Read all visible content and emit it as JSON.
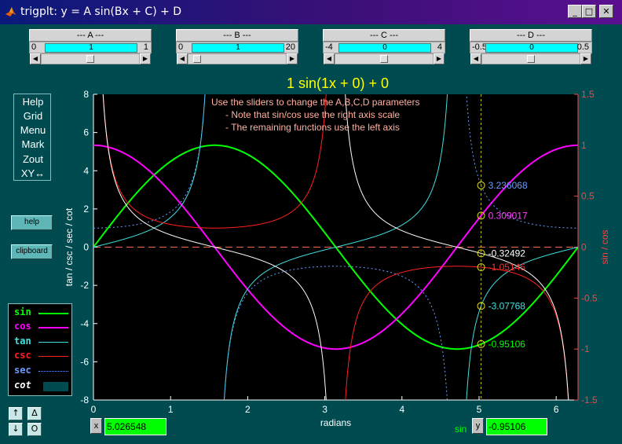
{
  "window": {
    "title": "trigplt: y = A sin(Bx + C) + D",
    "minimize_glyph": "_",
    "maximize_glyph": "□",
    "close_glyph": "✕"
  },
  "sliders": [
    {
      "name": "--- A ---",
      "min": "0",
      "max": "1",
      "value": "1",
      "fraction": 0.5
    },
    {
      "name": "--- B ---",
      "min": "0",
      "max": "20",
      "value": "1",
      "fraction": 0.05
    },
    {
      "name": "--- C ---",
      "min": "-4",
      "max": "4",
      "value": "0",
      "fraction": 0.5
    },
    {
      "name": "--- D ---",
      "min": "-0.5",
      "max": "0.5",
      "value": "0",
      "fraction": 0.5
    }
  ],
  "plot": {
    "title": "1 sin(1x + 0) + 0",
    "annotations": [
      "Use the sliders to change the A,B,C,D parameters",
      "- Note that sin/cos use the right axis scale",
      "- The remaining functions use the left axis"
    ]
  },
  "menu": [
    "Help",
    "Grid",
    "Menu",
    "Mark",
    "Zout",
    "XY↔"
  ],
  "buttons": {
    "help": "help",
    "clipboard": "clipboard"
  },
  "legend": [
    {
      "label": "sin",
      "color": "#00ff00",
      "style": "solid"
    },
    {
      "label": "cos",
      "color": "#ff00ff",
      "style": "solid"
    },
    {
      "label": "tan",
      "color": "#40e0e0",
      "style": "solid"
    },
    {
      "label": "csc",
      "color": "#ff2020",
      "style": "solid"
    },
    {
      "label": "sec",
      "color": "#6a9cff",
      "style": "dotted"
    },
    {
      "label": "cot",
      "color": "#ffffff",
      "style": "swatch"
    }
  ],
  "nav": {
    "up": "↑",
    "down": "↓",
    "delta": "Δ",
    "zero": "O"
  },
  "readout": {
    "x_button": "x",
    "x_value": "5.026548",
    "y_button": "y",
    "y_value": "-0.95106",
    "y_series": "sin"
  },
  "chart_data": {
    "type": "line",
    "xlabel": "radians",
    "ylabel_left": "tan / csc / sec / cot",
    "ylabel_right": "sin / cos",
    "xlim": [
      0,
      6.2832
    ],
    "ylim_left": [
      -8,
      8
    ],
    "ylim_right": [
      -1.5,
      1.5
    ],
    "x_ticks": [
      0,
      1,
      2,
      3,
      4,
      5,
      6
    ],
    "y_ticks_left": [
      -8,
      -6,
      -4,
      -2,
      0,
      2,
      4,
      6,
      8
    ],
    "y_ticks_right": [
      -1.5,
      -1,
      -0.5,
      0,
      0.5,
      1,
      1.5
    ],
    "series": [
      {
        "name": "sin",
        "function": "sin",
        "axis": "right",
        "color": "#00ff00"
      },
      {
        "name": "cos",
        "function": "cos",
        "axis": "right",
        "color": "#ff00ff"
      },
      {
        "name": "tan",
        "function": "tan",
        "axis": "left",
        "color": "#40e0e0"
      },
      {
        "name": "csc",
        "function": "csc",
        "axis": "left",
        "color": "#ff2020"
      },
      {
        "name": "sec",
        "function": "sec",
        "axis": "left",
        "color": "#6a9cff",
        "dashed": true
      },
      {
        "name": "cot",
        "function": "cot",
        "axis": "left",
        "color": "#ffffff"
      }
    ],
    "cursor_x": 5.026548,
    "markers": [
      {
        "series": "sec",
        "axis": "left",
        "y": 3.236068,
        "label": "3.236068",
        "color": "#6a9cff"
      },
      {
        "series": "cos",
        "axis": "right",
        "y": 0.309017,
        "label": "0.309017",
        "color": "#ff40ff"
      },
      {
        "series": "cot",
        "axis": "left",
        "y": -0.32492,
        "label": "-0.32492",
        "color": "#ffffff"
      },
      {
        "series": "csc",
        "axis": "left",
        "y": -1.05146,
        "label": "-1.05146",
        "color": "#ff3030"
      },
      {
        "series": "tan",
        "axis": "left",
        "y": -3.07768,
        "label": "-3.07768",
        "color": "#40e0e0"
      },
      {
        "series": "sin",
        "axis": "right",
        "y": -0.95106,
        "label": "-0.95106",
        "color": "#00ff00"
      }
    ],
    "grid": false
  }
}
